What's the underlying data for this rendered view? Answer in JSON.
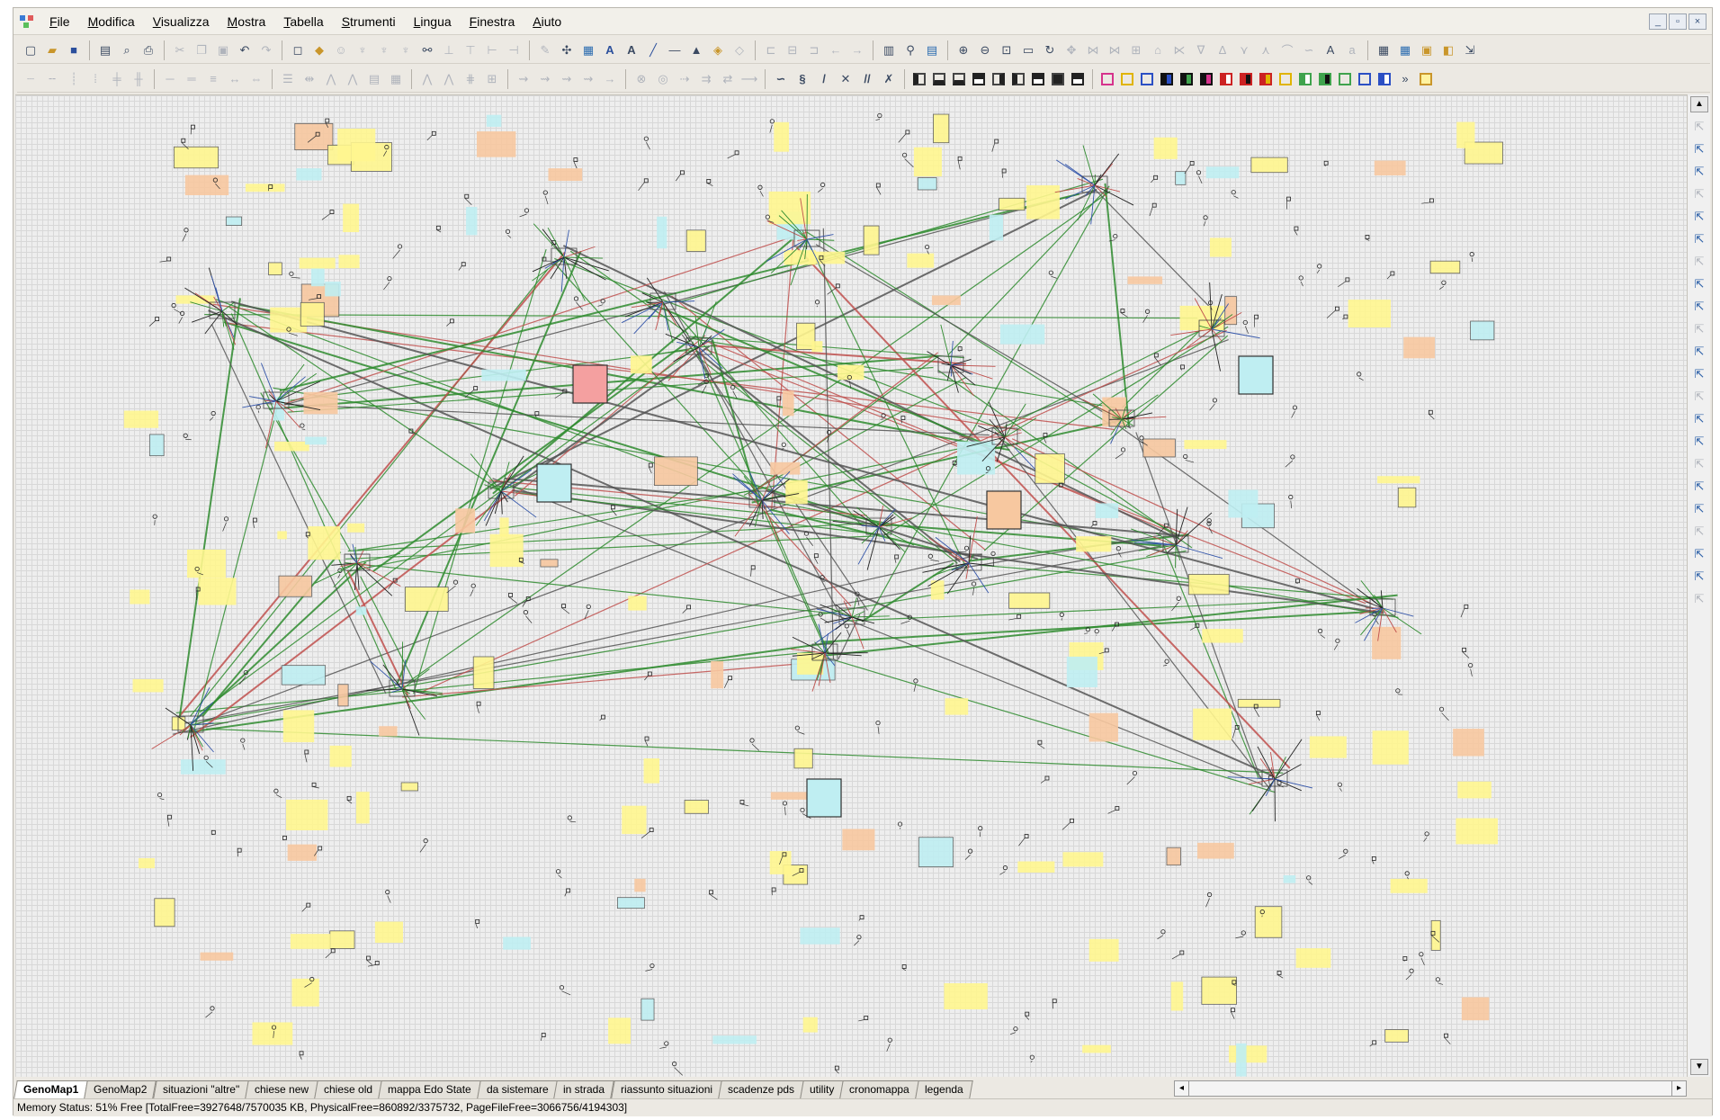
{
  "menu": {
    "items": [
      "File",
      "Modifica",
      "Visualizza",
      "Mostra",
      "Tabella",
      "Strumenti",
      "Lingua",
      "Finestra",
      "Aiuto"
    ]
  },
  "window_controls": {
    "minimize": "_",
    "restore": "▫",
    "close": "×"
  },
  "tabs": [
    {
      "label": "GenoMap1",
      "active": true
    },
    {
      "label": "GenoMap2",
      "active": false
    },
    {
      "label": "situazioni \"altre\"",
      "active": false
    },
    {
      "label": "chiese new",
      "active": false
    },
    {
      "label": "chiese old",
      "active": false
    },
    {
      "label": "mappa Edo State",
      "active": false
    },
    {
      "label": "da sistemare",
      "active": false
    },
    {
      "label": "in strada",
      "active": false
    },
    {
      "label": "riassunto situazioni",
      "active": false
    },
    {
      "label": "scadenze pds",
      "active": false
    },
    {
      "label": "utility",
      "active": false
    },
    {
      "label": "cronomappa",
      "active": false
    },
    {
      "label": "legenda",
      "active": false
    }
  ],
  "status": {
    "text": "Memory Status: 51% Free [TotalFree=3927648/7570035 KB, PhysicalFree=860892/3375732, PageFileFree=3066756/4194303]"
  },
  "colors": {
    "link_green": "#2e8b2e",
    "link_red": "#c0504d",
    "link_dark": "#555555",
    "note_yellow": "#fff68f",
    "note_orange": "#f7c8a0",
    "note_cyan": "#bfeef2"
  }
}
